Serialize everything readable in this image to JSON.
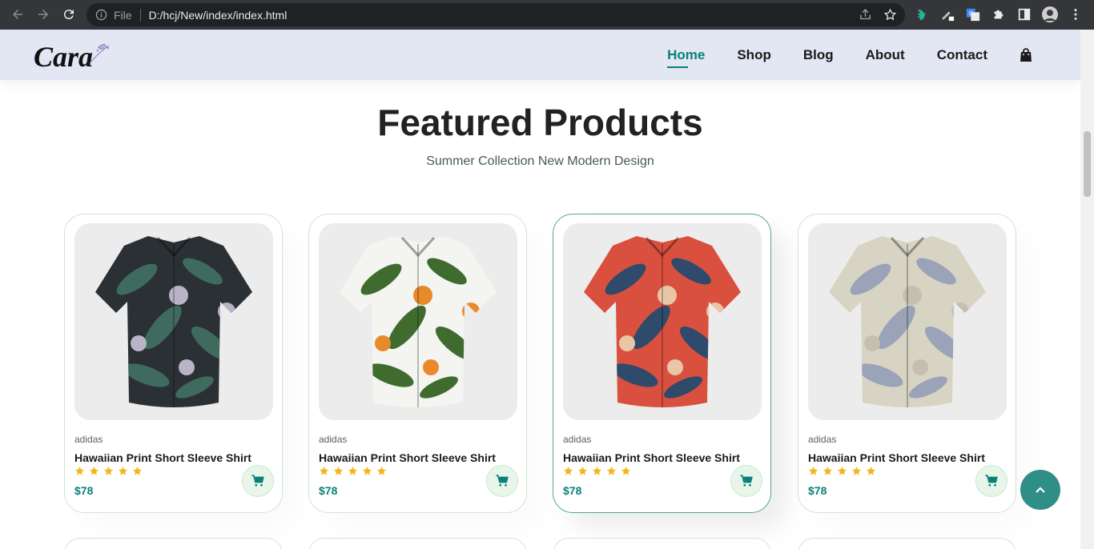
{
  "browser": {
    "file_label": "File",
    "url": "D:/hcj/New/index/index.html"
  },
  "header": {
    "logo_text": "Cara",
    "nav": [
      {
        "label": "Home",
        "active": true
      },
      {
        "label": "Shop",
        "active": false
      },
      {
        "label": "Blog",
        "active": false
      },
      {
        "label": "About",
        "active": false
      },
      {
        "label": "Contact",
        "active": false
      }
    ],
    "cart_icon": "shopping-bag-icon"
  },
  "section": {
    "title": "Featured Products",
    "subtitle": "Summer Collection New Modern Design"
  },
  "products": [
    {
      "brand": "adidas",
      "name": "Hawaiian Print Short Sleeve Shirt",
      "rating": 5,
      "price": "$78",
      "colors": {
        "base": "#2b3034",
        "leaf": "#3e6b5e",
        "accent": "#b9b3c9"
      }
    },
    {
      "brand": "adidas",
      "name": "Hawaiian Print Short Sleeve Shirt",
      "rating": 5,
      "price": "$78",
      "colors": {
        "base": "#f4f4f0",
        "leaf": "#3f6b2e",
        "accent": "#e8892a"
      }
    },
    {
      "brand": "adidas",
      "name": "Hawaiian Print Short Sleeve Shirt",
      "rating": 5,
      "price": "$78",
      "colors": {
        "base": "#d9503f",
        "leaf": "#2f4a6b",
        "accent": "#e9c7a6"
      }
    },
    {
      "brand": "adidas",
      "name": "Hawaiian Print Short Sleeve Shirt",
      "rating": 5,
      "price": "$78",
      "colors": {
        "base": "#d8d4c4",
        "leaf": "#9aa3b7",
        "accent": "#c4bfae"
      }
    }
  ],
  "theme": {
    "accent": "#088178",
    "star": "#f3b519",
    "header_bg": "#e3e6f3"
  }
}
